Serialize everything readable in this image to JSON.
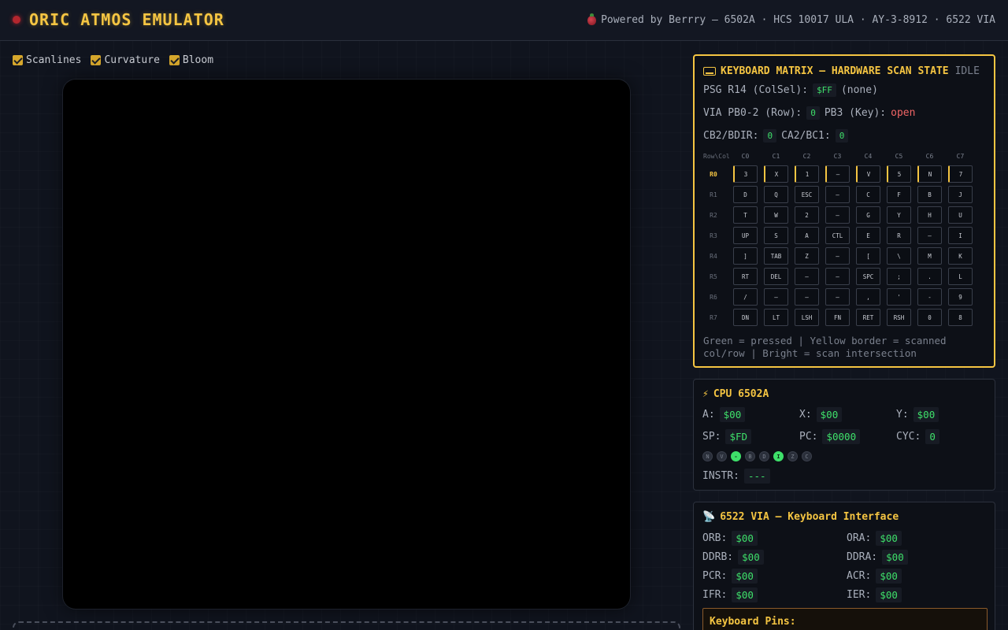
{
  "header": {
    "title": "ORIC ATMOS EMULATOR",
    "powered": "Powered by Berrry — 6502A · HCS 10017 ULA · AY-3-8912 · 6522 VIA"
  },
  "toggles": [
    {
      "label": "Scanlines",
      "checked": true
    },
    {
      "label": "Curvature",
      "checked": true
    },
    {
      "label": "Bloom",
      "checked": true
    }
  ],
  "keyboard": {
    "title": "KEYBOARD MATRIX — HARDWARE SCAN STATE",
    "state": "IDLE",
    "psg_label": "PSG R14 (ColSel):",
    "psg_value": "$FF",
    "psg_note": "(none)",
    "via_label": "VIA PB0-2 (Row):",
    "via_value": "0",
    "pb3_label": "PB3 (Key):",
    "pb3_value": "open",
    "cb2_label": "CB2/BDIR:",
    "cb2_value": "0",
    "ca2_label": "CA2/BC1:",
    "ca2_value": "0",
    "corner": "Row\\Col",
    "cols": [
      "C0",
      "C1",
      "C2",
      "C3",
      "C4",
      "C5",
      "C6",
      "C7"
    ],
    "rows": [
      "R0",
      "R1",
      "R2",
      "R3",
      "R4",
      "R5",
      "R6",
      "R7"
    ],
    "matrix": [
      [
        "3",
        "X",
        "1",
        "—",
        "V",
        "5",
        "N",
        "7"
      ],
      [
        "D",
        "Q",
        "ESC",
        "—",
        "C",
        "F",
        "B",
        "J"
      ],
      [
        "T",
        "W",
        "2",
        "—",
        "G",
        "Y",
        "H",
        "U"
      ],
      [
        "UP",
        "S",
        "A",
        "CTL",
        "E",
        "R",
        "—",
        "I"
      ],
      [
        "]",
        "TAB",
        "Z",
        "—",
        "[",
        "\\",
        "M",
        "K"
      ],
      [
        "RT",
        "DEL",
        "—",
        "—",
        "SPC",
        ";",
        ".",
        "L"
      ],
      [
        "/",
        "—",
        "—",
        "—",
        ",",
        "'",
        "-",
        "9"
      ],
      [
        "DN",
        "LT",
        "LSH",
        "FN",
        "RET",
        "RSH",
        "0",
        "8"
      ]
    ],
    "scanned_row": 0,
    "legend": "Green = pressed | Yellow border = scanned col/row | Bright = scan intersection"
  },
  "cpu": {
    "title": "CPU 6502A",
    "regs": [
      {
        "label": "A:",
        "value": "$00"
      },
      {
        "label": "X:",
        "value": "$00"
      },
      {
        "label": "Y:",
        "value": "$00"
      },
      {
        "label": "SP:",
        "value": "$FD"
      },
      {
        "label": "PC:",
        "value": "$0000"
      },
      {
        "label": "CYC:",
        "value": "0"
      }
    ],
    "flags": [
      {
        "name": "N",
        "on": false
      },
      {
        "name": "V",
        "on": false
      },
      {
        "name": "-",
        "on": true
      },
      {
        "name": "B",
        "on": false
      },
      {
        "name": "D",
        "on": false
      },
      {
        "name": "I",
        "on": true
      },
      {
        "name": "Z",
        "on": false
      },
      {
        "name": "C",
        "on": false
      }
    ],
    "instr_label": "INSTR:",
    "instr_value": "---"
  },
  "via": {
    "title": "6522 VIA — Keyboard Interface",
    "regs": [
      {
        "label": "ORB:",
        "value": "$00"
      },
      {
        "label": "ORA:",
        "value": "$00"
      },
      {
        "label": "DDRB:",
        "value": "$00"
      },
      {
        "label": "DDRA:",
        "value": "$00"
      },
      {
        "label": "PCR:",
        "value": "$00"
      },
      {
        "label": "ACR:",
        "value": "$00"
      },
      {
        "label": "IFR:",
        "value": "$00"
      },
      {
        "label": "IER:",
        "value": "$00"
      }
    ],
    "pins_title": "Keyboard Pins:"
  }
}
